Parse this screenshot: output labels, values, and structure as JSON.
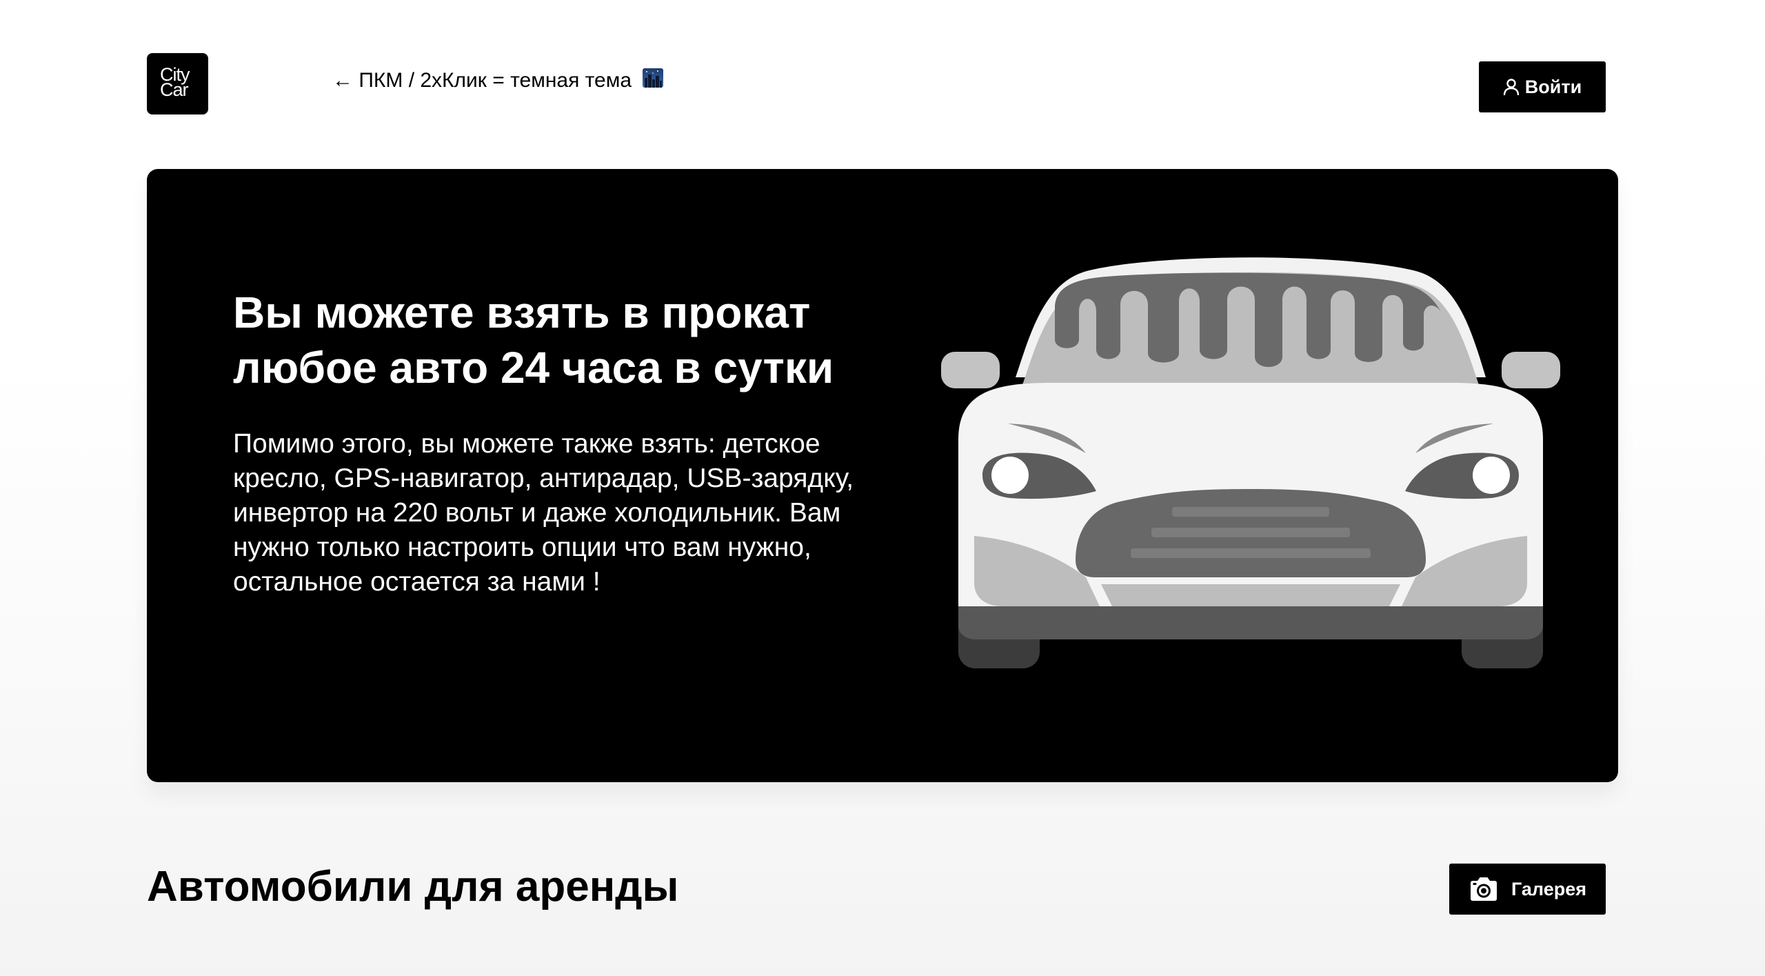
{
  "header": {
    "logo_line1": "City",
    "logo_line2": "Car",
    "theme_hint": "← ПКМ / 2хКлик = темная тема",
    "theme_hint_icon": "night-city-icon",
    "login_label": "Войти",
    "login_icon": "user-icon"
  },
  "hero": {
    "title": "Вы можете взять в прокат любое авто 24 часа в сутки",
    "text": "Помимо этого, вы можете также взять: детское кресло, GPS-навигатор, антирадар, USB-зарядку, инвертор на 220 вольт и даже холодильник. Вам нужно только настроить опции что вам нужно, остальное остается за нами !",
    "image": "car-front-illustration",
    "background": "#000000"
  },
  "section": {
    "title": "Автомобили для аренды",
    "gallery_label": "Галерея",
    "gallery_icon": "camera-icon"
  },
  "colors": {
    "primary": "#000000",
    "text_on_dark": "#ffffff",
    "page_background": "#ffffff"
  }
}
